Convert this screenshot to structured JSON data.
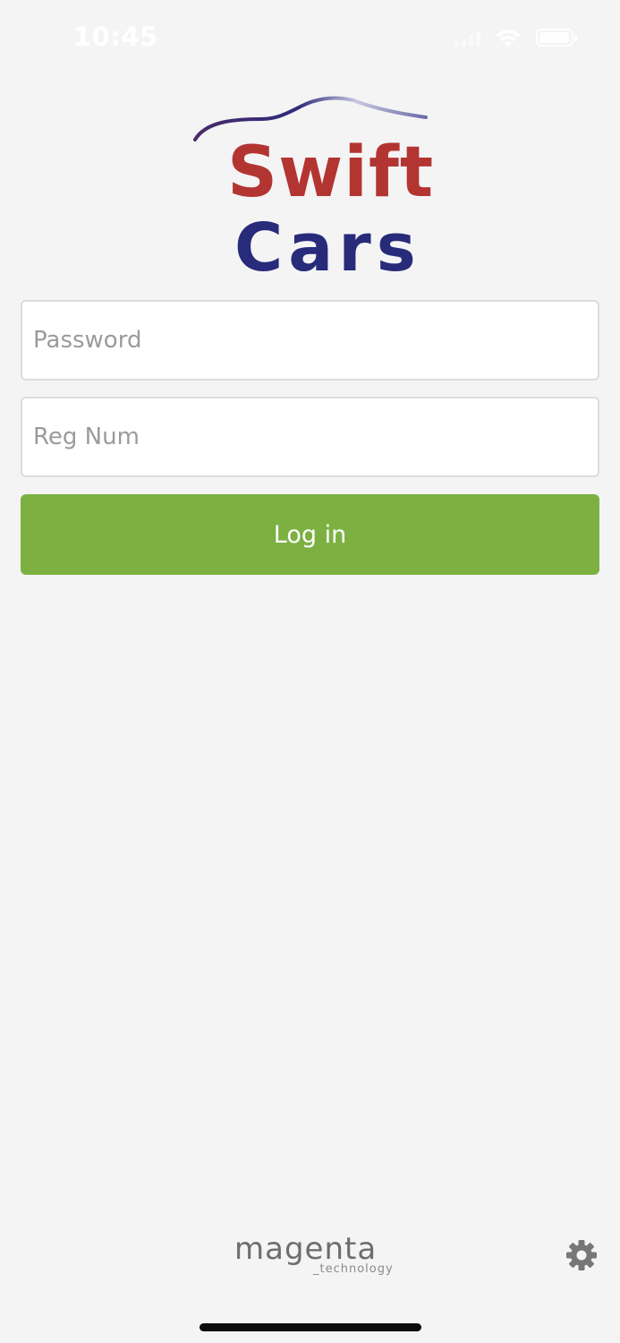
{
  "status_bar": {
    "time": "10:45"
  },
  "logo": {
    "line1": "Swift",
    "line2": "Cars",
    "colors": {
      "swift": "#b33532",
      "cars": "#272b7a",
      "swoosh_start": "#4a2a6a",
      "swoosh_end": "#b7b5d8"
    }
  },
  "form": {
    "password_placeholder": "Password",
    "password_value": "",
    "reg_placeholder": "Reg Num",
    "reg_value": "",
    "login_label": "Log in",
    "login_color": "#7cb142"
  },
  "footer": {
    "brand_name": "magenta",
    "brand_sub": "_technology",
    "settings_icon": "gear-icon"
  }
}
